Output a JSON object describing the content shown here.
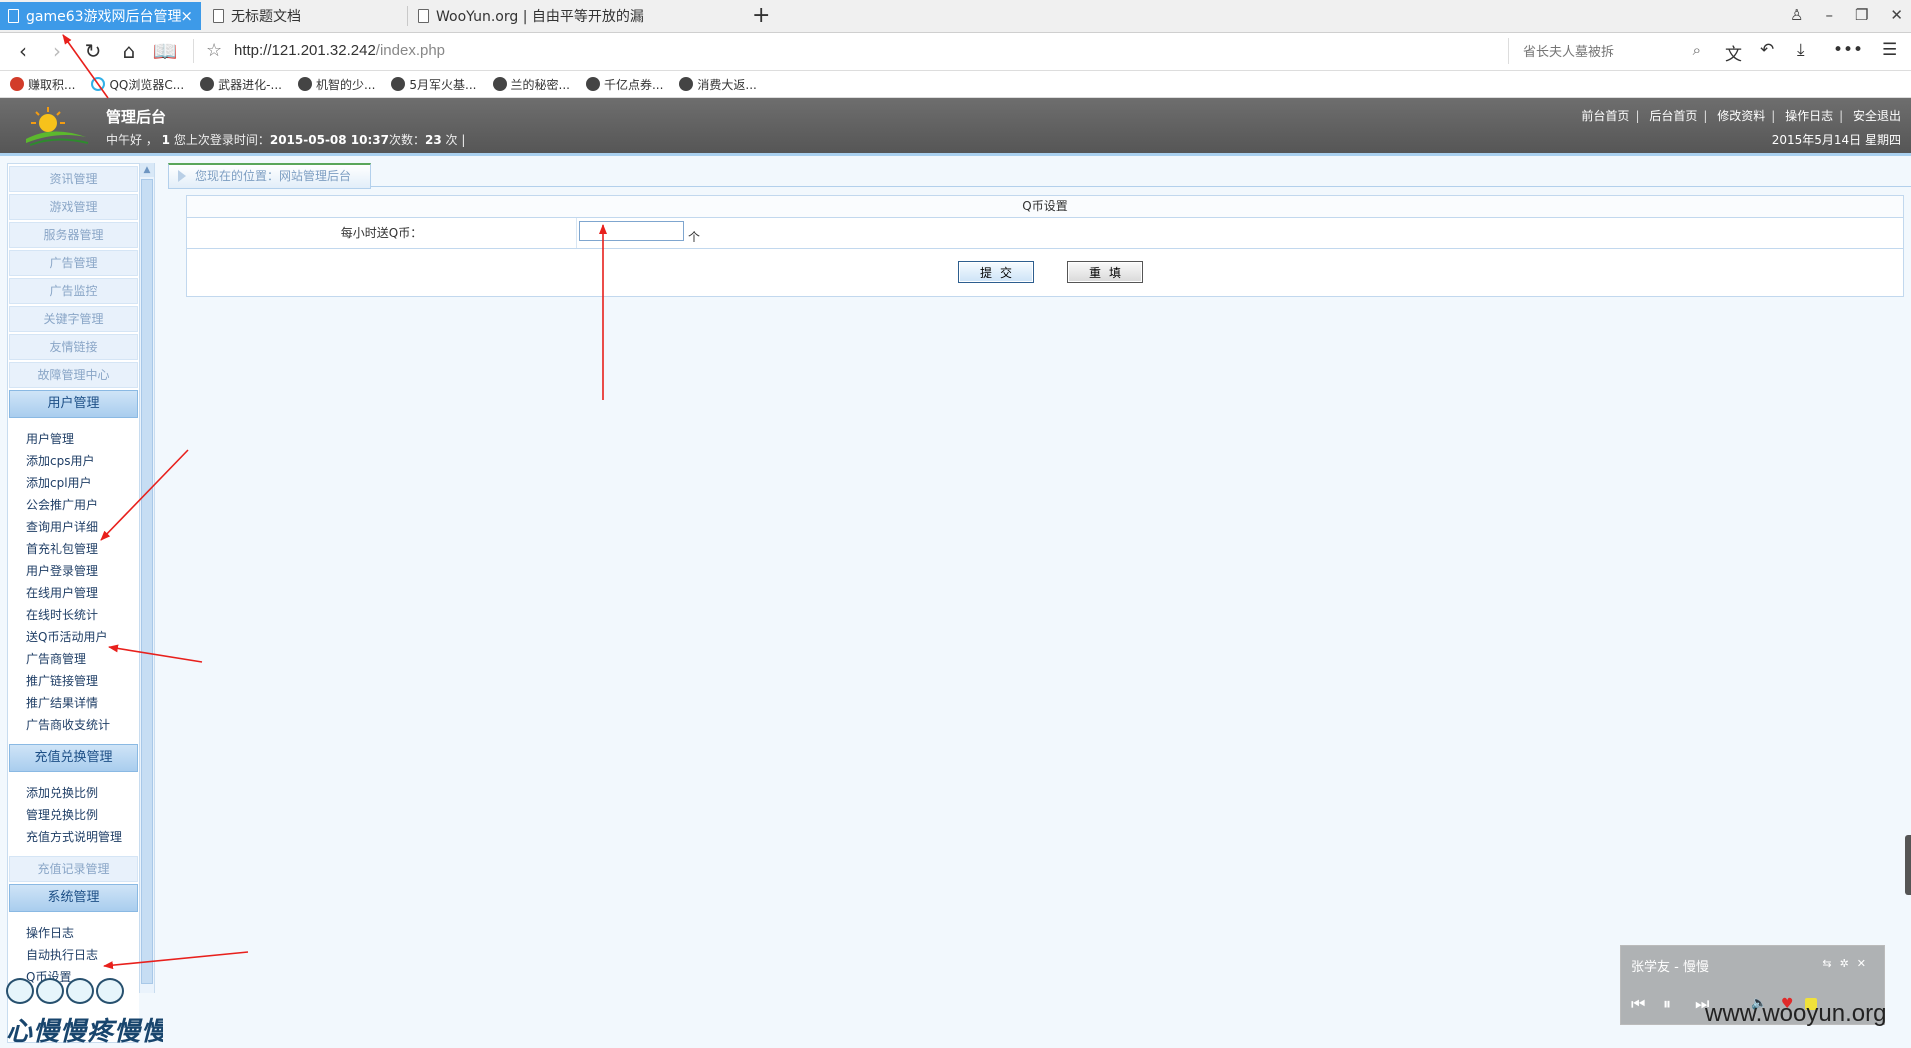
{
  "browser": {
    "tabs": [
      {
        "title": "game63游戏网后台管理",
        "active": true,
        "close": "×"
      },
      {
        "title": "无标题文档",
        "active": false
      },
      {
        "title": "WooYun.org | 自由平等开放的漏",
        "active": false
      }
    ],
    "new_tab": "+",
    "url_host": "http://121.201.32.242",
    "url_path": "/index.php",
    "search_placeholder": "省长夫人墓被拆",
    "bookmarks": [
      "赚取积...",
      "QQ浏览器C...",
      "武器进化-...",
      "机智的少...",
      "5月军火基...",
      "兰的秘密...",
      "千亿点券...",
      "消费大返..."
    ],
    "icons": [
      "back-icon",
      "forward-icon",
      "reload-icon",
      "home-icon",
      "reader-icon",
      "star-icon",
      "search-icon",
      "translate-icon",
      "undo-icon",
      "download-icon",
      "more-icon",
      "menu-icon"
    ]
  },
  "header": {
    "title": "管理后台",
    "greeting_prefix": "中午好 ，",
    "user": "1",
    "last_login_label": "您上次登录时间：",
    "last_login": "2015-05-08 10:37",
    "count_label": "次数：",
    "count": "23",
    "count_suffix": "次 |",
    "links": [
      "前台首页",
      "后台首页",
      "修改资料",
      "操作日志",
      "安全退出"
    ],
    "date": "2015年5月14日 星期四"
  },
  "sidebar": {
    "categories_top": [
      "资讯管理",
      "游戏管理",
      "服务器管理",
      "广告管理",
      "广告监控",
      "关键字管理",
      "友情链接",
      "故障管理中心"
    ],
    "user_mgmt": {
      "title": "用户管理",
      "items": [
        "用户管理",
        "添加cps用户",
        "添加cpl用户",
        "公会推广用户",
        "查询用户详细",
        "首充礼包管理",
        "用户登录管理",
        "在线用户管理",
        "在线时长统计",
        "送Q币活动用户",
        "广告商管理",
        "推广链接管理",
        "推广结果详情",
        "广告商收支统计"
      ]
    },
    "recharge": {
      "title": "充值兑换管理",
      "items": [
        "添加兑换比例",
        "管理兑换比例",
        "充值方式说明管理"
      ]
    },
    "recharge_log": "充值记录管理",
    "system": {
      "title": "系统管理",
      "items": [
        "操作日志",
        "自动执行日志",
        "Q币设置"
      ]
    }
  },
  "main": {
    "breadcrumb": "您现在的位置：网站管理后台",
    "form_title": "Q币设置",
    "field_label": "每小时送Q币：",
    "field_value": "",
    "unit": "个",
    "submit": "提交",
    "reset": "重填"
  },
  "player": {
    "song": "张学友 - 慢慢"
  },
  "watermarks": {
    "left": "心慢慢疼慢慢冷",
    "right": "www.wooyun.org"
  },
  "colors": {
    "tab_active": "#3d9ae8",
    "header_bg": "#5f5f5f",
    "annotation": "#e8201c"
  }
}
